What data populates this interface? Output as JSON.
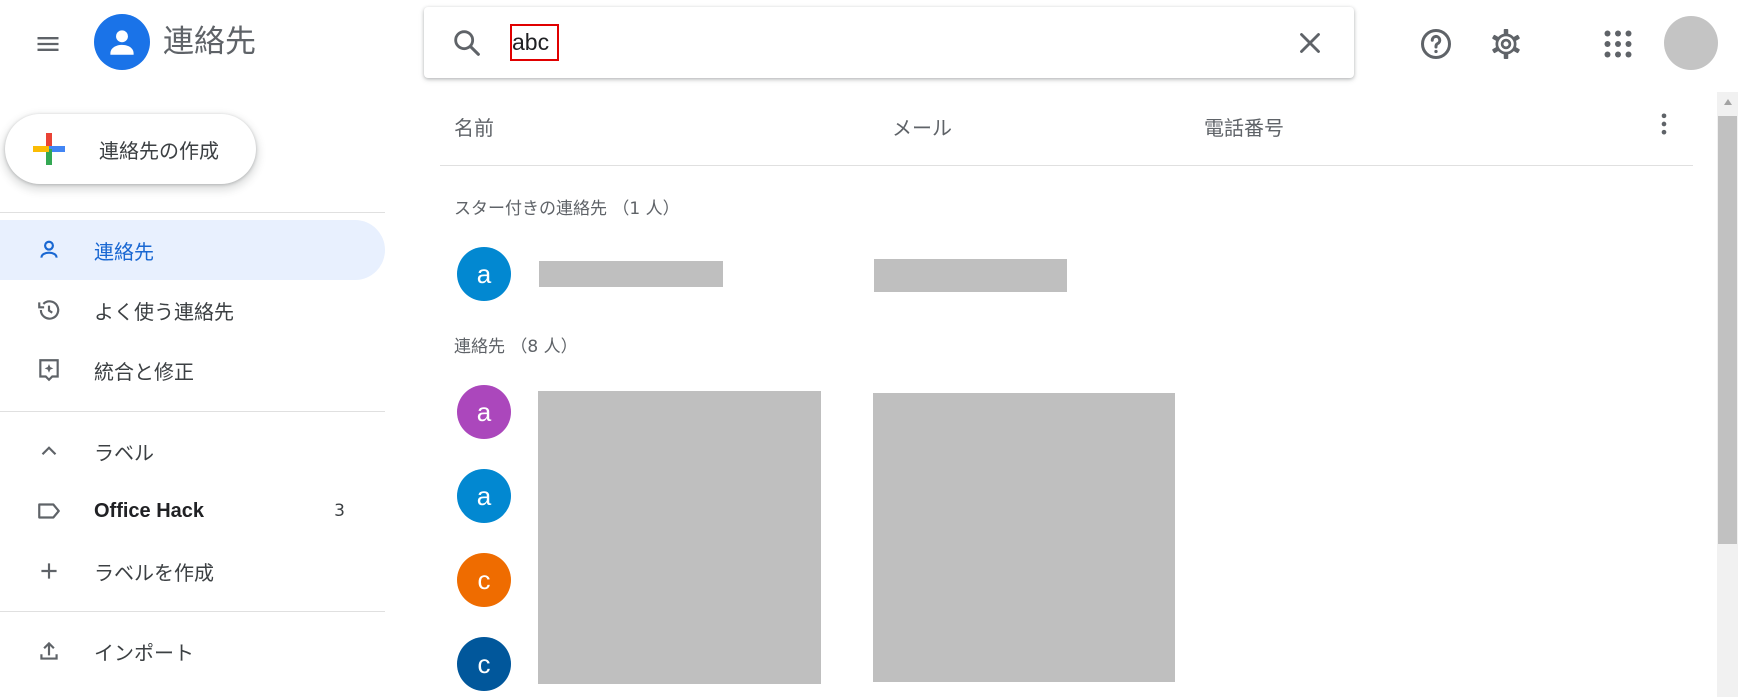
{
  "header": {
    "app_title": "連絡先",
    "menu_icon": "hamburger-menu-icon",
    "logo_icon": "person-icon",
    "brand_color": "#1a73e8",
    "search": {
      "value": "abc",
      "icons": [
        "search-icon",
        "close-icon"
      ]
    },
    "right_icons": [
      "help-icon",
      "gear-icon",
      "apps-grid-icon",
      "avatar"
    ]
  },
  "sidebar": {
    "create_label": "連絡先の作成",
    "items": [
      {
        "label": "連絡先",
        "icon": "person-outline-icon",
        "active": true
      },
      {
        "label": "よく使う連絡先",
        "icon": "history-icon"
      },
      {
        "label": "統合と修正",
        "icon": "merge-fix-icon"
      }
    ],
    "labels_header": "ラベル",
    "labels": [
      {
        "label": "Office Hack",
        "count": "3",
        "icon": "label-icon"
      }
    ],
    "create_label_item": "ラベルを作成",
    "import_label": "インポート",
    "active_bg": "#e8f0fe",
    "active_color": "#1967d2"
  },
  "main": {
    "columns": [
      "名前",
      "メール",
      "電話番号"
    ],
    "starred_header": "スター付きの連絡先 （1 人）",
    "contacts_header": "連絡先 （8 人）",
    "starred": [
      {
        "initial": "a",
        "color": "#0288d1"
      }
    ],
    "contacts": [
      {
        "initial": "a",
        "color": "#ab47bc"
      },
      {
        "initial": "a",
        "color": "#0288d1"
      },
      {
        "initial": "c",
        "color": "#ef6c00"
      },
      {
        "initial": "c",
        "color": "#01579b"
      }
    ]
  }
}
